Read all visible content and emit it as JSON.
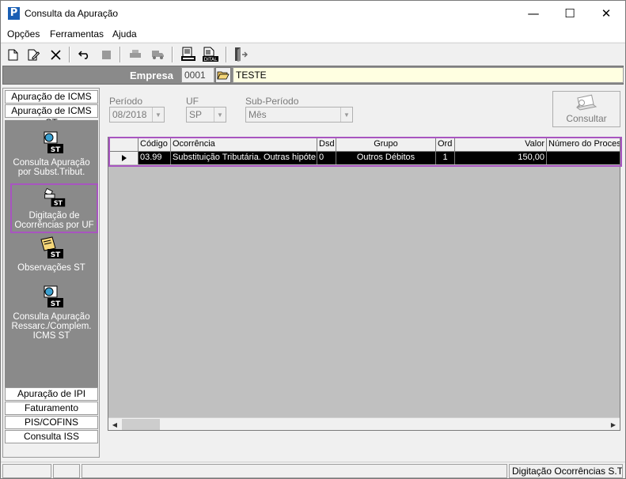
{
  "window": {
    "title": "Consulta da Apuração",
    "app_icon_letter": "P",
    "controls": {
      "minimize": "—",
      "maximize": "☐",
      "close": "✕"
    }
  },
  "menu": {
    "items": [
      "Opções",
      "Ferramentas",
      "Ajuda"
    ]
  },
  "toolbar": {
    "icons": [
      "new-document-icon",
      "edit-document-icon",
      "delete-icon",
      "undo-icon",
      "stop-icon",
      "print-icon",
      "truck-icon",
      "report-icon",
      "digital-icon",
      "exit-door-icon"
    ]
  },
  "company": {
    "label": "Empresa",
    "code": "0001",
    "name": "TESTE"
  },
  "left_panel": {
    "tabs_top": [
      "Apuração de ICMS",
      "Apuração de ICMS ST"
    ],
    "items": [
      {
        "label_line1": "Consulta  Apuração",
        "label_line2": "por Subst.Tribut.",
        "label_line3": ""
      },
      {
        "label_line1": "Digitação de",
        "label_line2": "Ocorrências por UF",
        "label_line3": ""
      },
      {
        "label_line1": "Observações ST",
        "label_line2": "",
        "label_line3": ""
      },
      {
        "label_line1": "Consulta Apuração",
        "label_line2": "Ressarc./Complem.",
        "label_line3": "ICMS ST"
      }
    ],
    "tabs_bottom": [
      "Apuração de IPI",
      "Faturamento",
      "PIS/COFINS",
      "Consulta ISS"
    ]
  },
  "filters": {
    "periodo_label": "Período",
    "periodo_value": "08/2018",
    "uf_label": "UF",
    "uf_value": "SP",
    "subperiodo_label": "Sub-Período",
    "subperiodo_value": "Mês",
    "consultar_label": "Consultar"
  },
  "grid": {
    "columns": [
      "Código",
      "Ocorrência",
      "Dsd",
      "Grupo",
      "Ord",
      "Valor",
      "Número do Processo"
    ],
    "rows": [
      [
        "03.99",
        "Substituição Tributária. Outras hipóte",
        "0",
        "Outros Débitos",
        "1",
        "150,00",
        ""
      ]
    ]
  },
  "status": {
    "right_text": "Digitação Ocorrências S.T"
  },
  "colors": {
    "highlight": "#a855c0",
    "panel_gray": "#8a8a8a",
    "company_name_bg": "#ffffe1",
    "title_icon_blue": "#1a5fb4"
  }
}
